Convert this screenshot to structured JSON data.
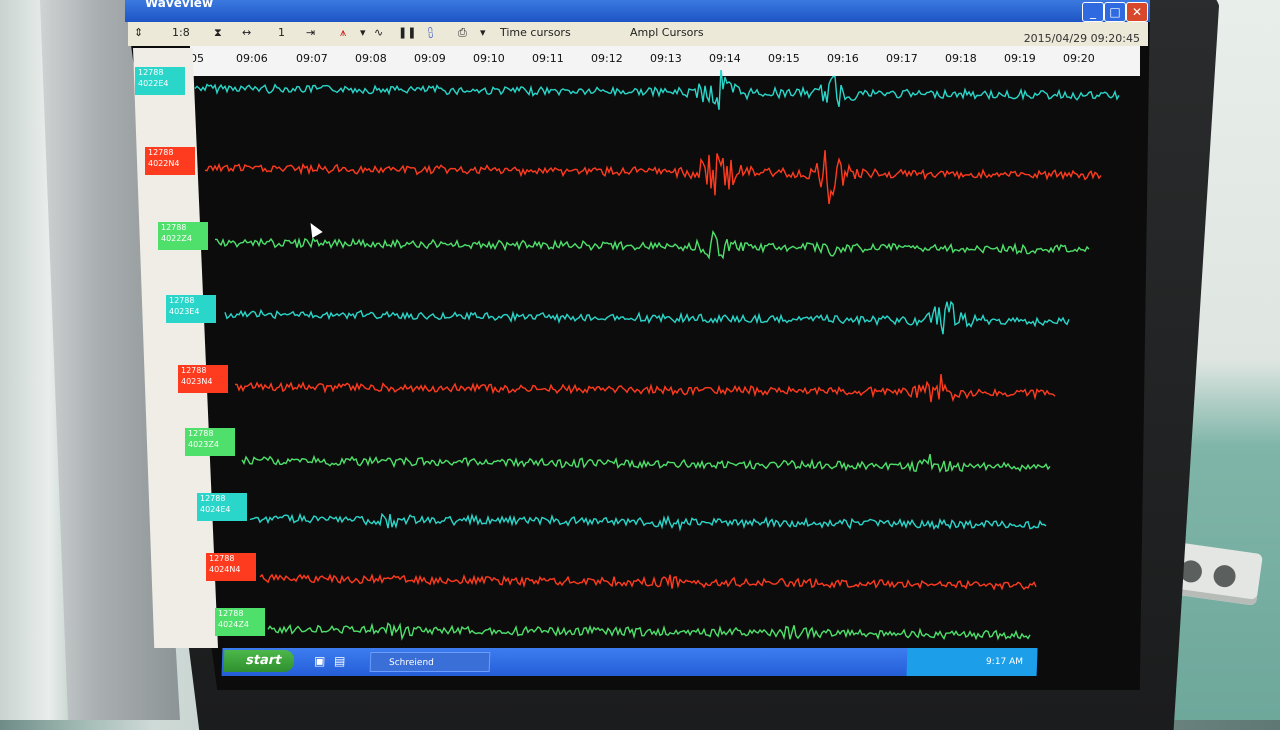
{
  "window": {
    "title": "Waveview",
    "controls": {
      "minimize": "_",
      "maximize": "□",
      "close": "✕"
    }
  },
  "toolbar": {
    "scale_value": "1:8",
    "step_value": "1",
    "time_cursors_label": "Time cursors",
    "ampl_cursors_label": "Ampl Cursors"
  },
  "axis": {
    "datestamp": "2015/04/29 09:20:45",
    "ticks": [
      "05",
      "09:06",
      "09:07",
      "09:08",
      "09:09",
      "09:10",
      "09:11",
      "09:12",
      "09:13",
      "09:14",
      "09:15",
      "09:16",
      "09:17",
      "09:18",
      "09:19",
      "09:20"
    ]
  },
  "channels": [
    {
      "label_line1": "12788",
      "label_line2": "4022E4",
      "color": "#2ad6c9"
    },
    {
      "label_line1": "12788",
      "label_line2": "4022N4",
      "color": "#ff3b1f"
    },
    {
      "label_line1": "12788",
      "label_line2": "4022Z4",
      "color": "#4ee06a"
    },
    {
      "label_line1": "12788",
      "label_line2": "4023E4",
      "color": "#2ad6c9"
    },
    {
      "label_line1": "12788",
      "label_line2": "4023N4",
      "color": "#ff3b1f"
    },
    {
      "label_line1": "12788",
      "label_line2": "4023Z4",
      "color": "#4ee06a"
    },
    {
      "label_line1": "12788",
      "label_line2": "4024E4",
      "color": "#2ad6c9"
    },
    {
      "label_line1": "12788",
      "label_line2": "4024N4",
      "color": "#ff3b1f"
    },
    {
      "label_line1": "12788",
      "label_line2": "4024Z4",
      "color": "#4ee06a"
    }
  ],
  "taskbar": {
    "start_label": "start",
    "task_item_label": "Schreiend",
    "clock": "9:17 AM"
  }
}
